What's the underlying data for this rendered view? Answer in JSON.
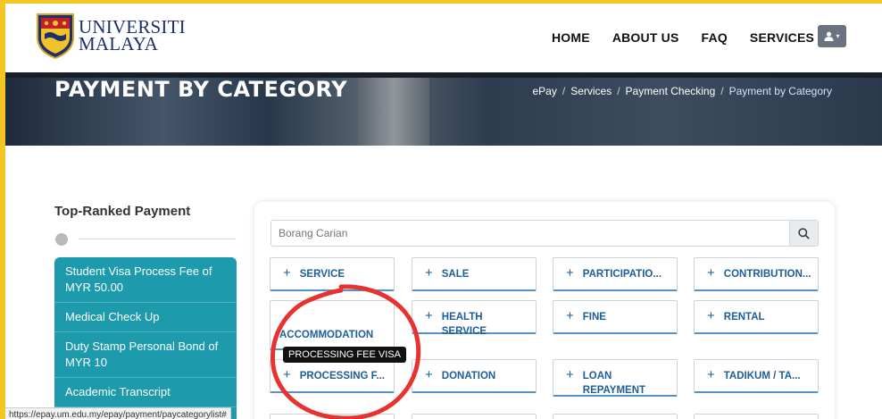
{
  "header": {
    "logo_line1": "UNIVERSITI",
    "logo_line2": "MALAYA",
    "nav": [
      "HOME",
      "ABOUT US",
      "FAQ",
      "SERVICES"
    ]
  },
  "banner": {
    "title": "PAYMENT BY CATEGORY",
    "breadcrumb": [
      "ePay",
      "Services",
      "Payment Checking",
      "Payment by Category"
    ]
  },
  "sidebar": {
    "title": "Top-Ranked Payment",
    "items": [
      "Student Visa Process Fee of MYR 50.00",
      "Medical Check Up",
      "Duty Stamp Personal Bond of MYR 10",
      "Academic Transcript"
    ]
  },
  "search": {
    "placeholder": "Borang Carian"
  },
  "categories": [
    "SERVICE",
    "SALE",
    "PARTICIPATIO...",
    "CONTRIBUTION...",
    "ACCOMMODATION",
    "HEALTH SERVICE",
    "FINE",
    "RENTAL",
    "PROCESSING F...",
    "DONATION",
    "LOAN REPAYMENT",
    "TADIKUM / TA..."
  ],
  "tooltip": "PROCESSING FEE VISA",
  "status_url": "https://epay.um.edu.my/epay/payment/paycategorylist#",
  "colors": {
    "accent_teal": "#1d9aab",
    "link_blue": "#1e5d99",
    "annotation_red": "#e8322f",
    "frame_yellow": "#f3c623"
  }
}
